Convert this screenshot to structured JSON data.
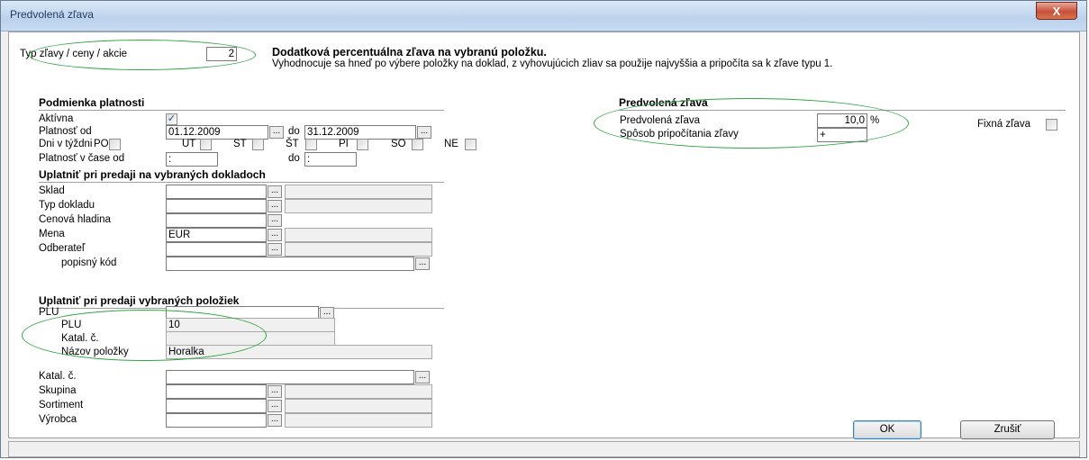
{
  "window": {
    "title": "Predvolená zľava",
    "close_label": "X"
  },
  "top": {
    "typ_label": "Typ zľavy / ceny / akcie",
    "typ_value": "2",
    "desc_title": "Dodatková percentuálna zľava na vybranú položku.",
    "desc_text": "Vyhodnocuje sa hneď po výbere položky na doklad, z vyhovujúcich zliav sa použije najvyššia a pripočíta sa k zľave typu 1."
  },
  "podmienka": {
    "heading": "Podmienka platnosti",
    "aktivna_label": "Aktívna",
    "aktivna_checked": true,
    "platnost_od_label": "Platnosť od",
    "platnost_od_value": "01.12.2009",
    "do_label": "do",
    "do_value": "31.12.2009",
    "dni_label": "Dni v týždni",
    "days": [
      "PO",
      "UT",
      "ST",
      "ŠT",
      "PI",
      "SO",
      "NE"
    ],
    "cas_label": "Platnosť v čase od",
    "cas_od_value": ":",
    "cas_do_label": "do",
    "cas_do_value": ":"
  },
  "doklady": {
    "heading": "Uplatniť pri predaji na vybraných dokladoch",
    "sklad_label": "Sklad",
    "typ_dokladu_label": "Typ dokladu",
    "cenova_hladina_label": "Cenová hladina",
    "mena_label": "Mena",
    "mena_value": "EUR",
    "odberatel_label": "Odberateľ",
    "popisny_kod_label": "popisný kód"
  },
  "polozky": {
    "heading": "Uplatniť pri predaji vybraných položiek",
    "plu_label": "PLU",
    "plu_sub_label": "PLU",
    "plu_sub_value": "10",
    "katal_sub_label": "Katal. č.",
    "nazov_label": "Názov položky",
    "nazov_value": "Horalka",
    "katal_label": "Katal. č.",
    "skupina_label": "Skupina",
    "sortiment_label": "Sortiment",
    "vyrobca_label": "Výrobca"
  },
  "predvolena": {
    "heading": "Predvolená zľava",
    "zlava_label": "Predvolená zľava",
    "zlava_value": "10,0",
    "percent": "%",
    "sposob_label": "Spôsob pripočítania zľavy",
    "sposob_value": "+",
    "fixna_label": "Fixná zľava"
  },
  "buttons": {
    "ok": "OK",
    "cancel": "Zrušiť",
    "ellipsis": "..."
  },
  "colors": {
    "highlight_ellipse": "#2fa542",
    "title_bg": "#c7dbf2"
  }
}
